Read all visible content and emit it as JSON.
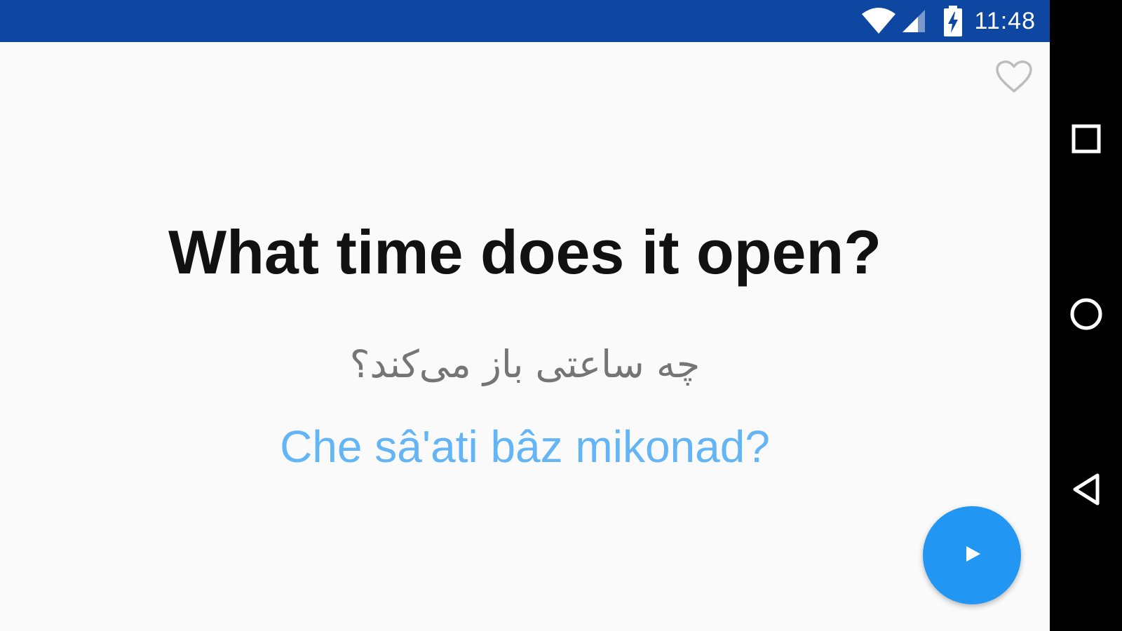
{
  "status_bar": {
    "time": "11:48",
    "background_color": "#0d47a1",
    "icons": [
      "wifi-icon",
      "cell-signal-icon",
      "battery-charging-icon"
    ]
  },
  "card": {
    "favorite_icon": "heart-outline-icon",
    "english": "What time does it open?",
    "persian": "چه ساعتی باز می‌کند؟",
    "transliteration": "Che sâ'ati bâz mikonad?",
    "play_icon": "play-icon"
  },
  "colors": {
    "background": "#fafafa",
    "english_text": "#111111",
    "persian_text": "#757575",
    "transliteration_text": "#64b5f6",
    "play_button": "#2196f3"
  },
  "nav_bar": {
    "buttons": [
      "recents-square-icon",
      "home-circle-icon",
      "back-triangle-icon"
    ]
  }
}
